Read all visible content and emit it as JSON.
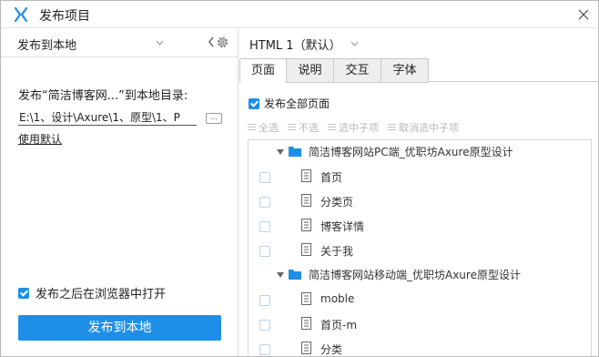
{
  "window": {
    "title": "发布项目",
    "accent": "#1e8ee6"
  },
  "left": {
    "target": "发布到本地",
    "publish_label": "发布“简洁博客网...”到本地目录:",
    "path_value": "E:\\1、设计\\Axure\\1、原型\\1、P",
    "browse_label": "...",
    "use_default": "使用默认",
    "open_in_browser": {
      "label": "发布之后在浏览器中打开",
      "checked": true
    },
    "publish_button": "发布到本地"
  },
  "right": {
    "config": "HTML 1（默认）",
    "tabs": [
      "页面",
      "说明",
      "交互",
      "字体"
    ],
    "active_tab": "页面",
    "publish_all": {
      "label": "发布全部页面",
      "checked": true
    },
    "toolbar": [
      "全选",
      "不选",
      "选中子项",
      "取消选中子项"
    ],
    "tree": [
      {
        "type": "folder",
        "label": "简洁博客网站PC端_优职坊Axure原型设计"
      },
      {
        "type": "page",
        "label": "首页"
      },
      {
        "type": "page",
        "label": "分类页"
      },
      {
        "type": "page",
        "label": "博客详情"
      },
      {
        "type": "page",
        "label": "关于我"
      },
      {
        "type": "folder",
        "label": "简洁博客网站移动端_优职坊Axure原型设计"
      },
      {
        "type": "page",
        "label": "moble"
      },
      {
        "type": "page",
        "label": "首页-m"
      },
      {
        "type": "page",
        "label": "分类"
      }
    ]
  },
  "icons": [
    "app-logo-icon",
    "close-icon",
    "chevron-down-icon",
    "collapse-left-icon",
    "gear-icon",
    "folder-icon",
    "page-icon",
    "expand-triangle-icon"
  ]
}
